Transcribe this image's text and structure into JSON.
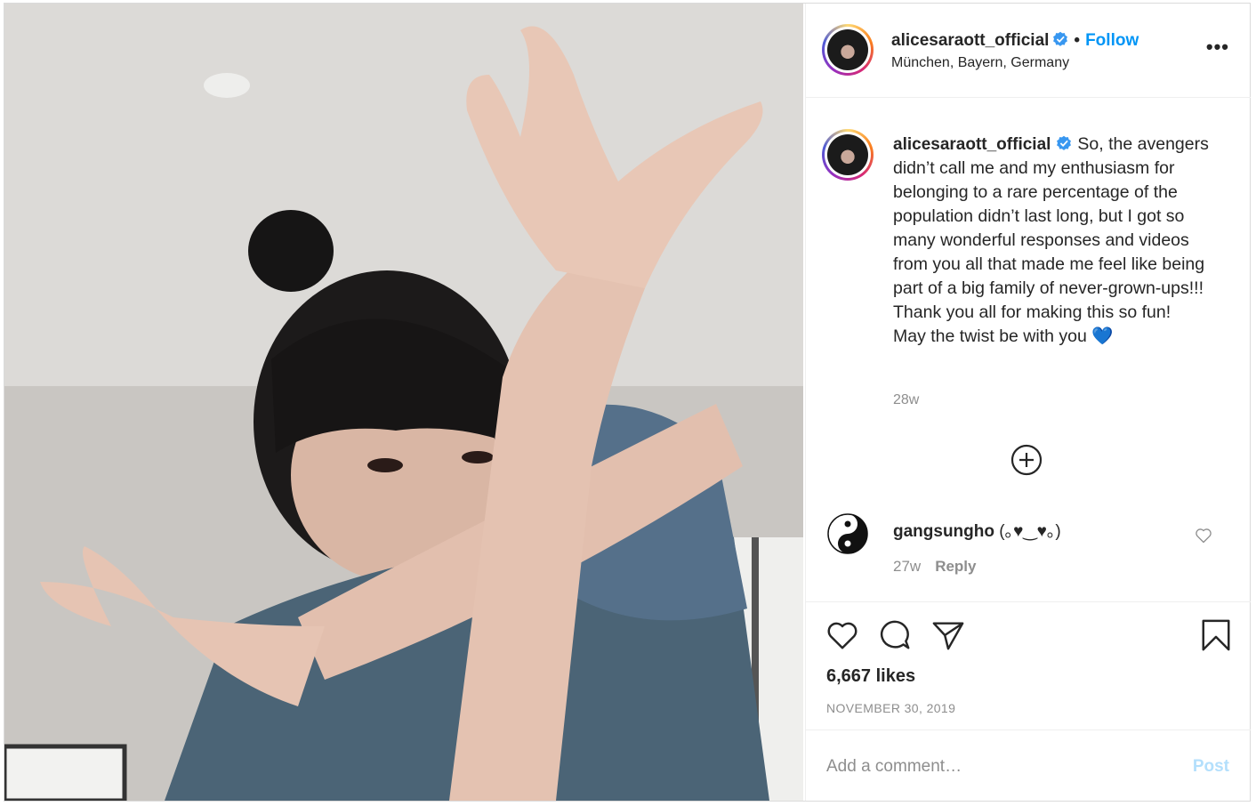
{
  "post": {
    "username": "alicesaraott_official",
    "dot": "•",
    "follow_label": "Follow",
    "location": "München, Bayern, Germany",
    "more_label": "•••"
  },
  "caption": {
    "username": "alicesaraott_official",
    "text": "So, the avengers didn’t call me and my enthusiasm for belonging to a rare percentage of the population didn’t last long, but I got so many wonderful responses and videos from you all that made me feel like being part of a big family of never-grown-ups!!! Thank you all for making this so fun!",
    "text_line2": "May the twist be with you",
    "emoji": "💙",
    "time": "28w"
  },
  "comment": {
    "username": "gangsungho",
    "text": "(｡♥‿♥｡)",
    "time": "27w",
    "reply_label": "Reply"
  },
  "stats": {
    "likes": "6,667 likes",
    "date": "NOVEMBER 30, 2019"
  },
  "comment_bar": {
    "placeholder": "Add a comment…",
    "post_label": "Post"
  },
  "colors": {
    "accent": "#0095f6",
    "verified": "#3897f0",
    "post_disabled": "#b3dffc",
    "secondary_text": "#8e8e8e"
  }
}
